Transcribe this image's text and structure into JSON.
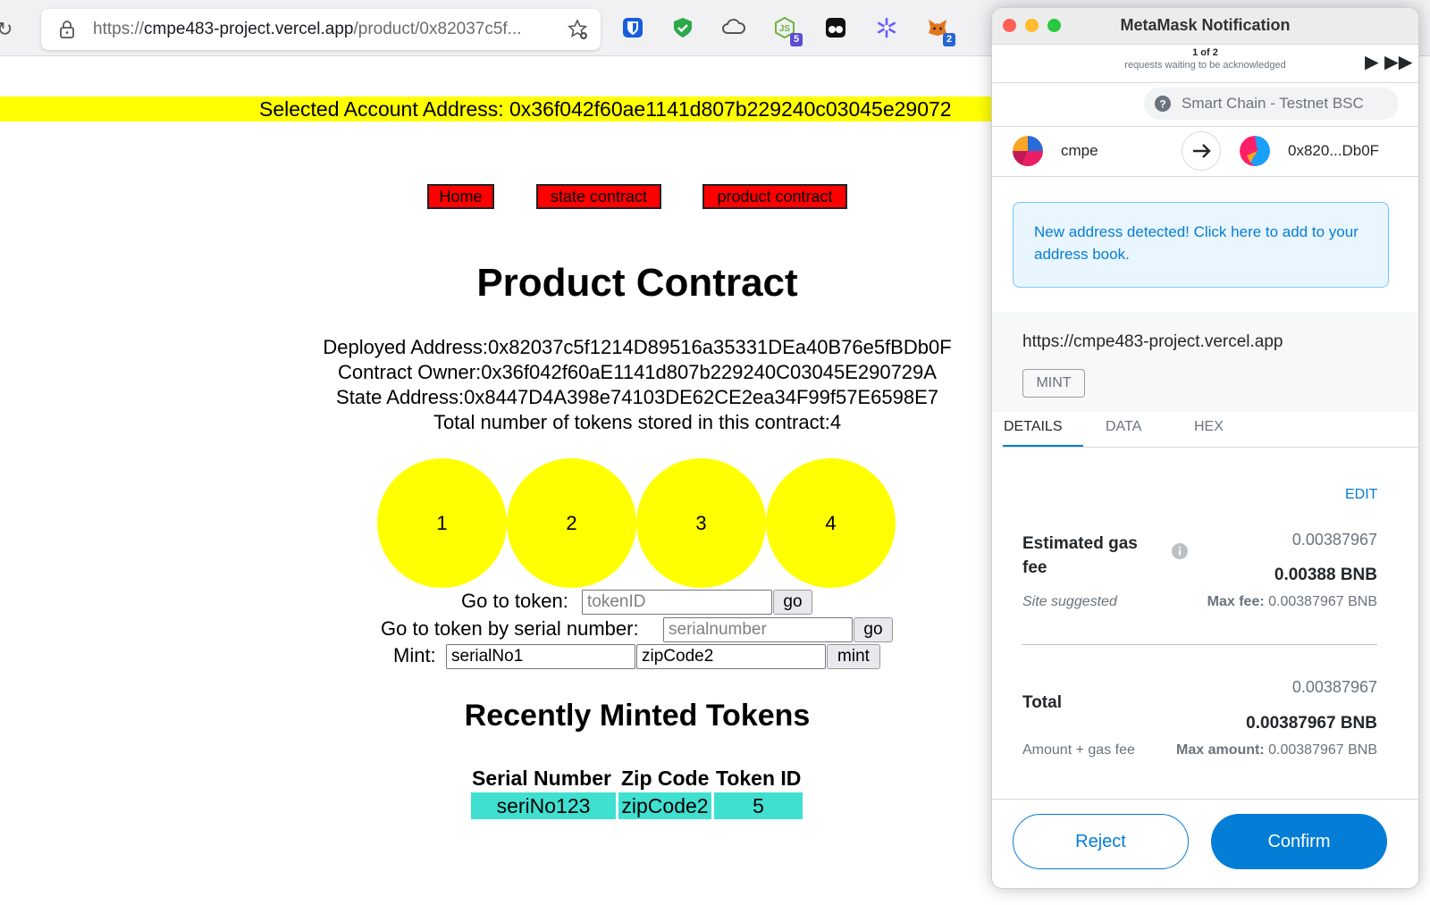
{
  "browser": {
    "url_prefix": "https://",
    "url_host": "cmpe483-project.vercel.app",
    "url_path": "/product/0x82037c5f...",
    "extensions": [
      {
        "name": "bitwarden",
        "color": "#175ddc",
        "badge": ""
      },
      {
        "name": "shield",
        "color": "#2ba84a",
        "badge": ""
      },
      {
        "name": "cloud",
        "color": "#555555",
        "badge": ""
      },
      {
        "name": "node",
        "color": "#6db33f",
        "badge": "5"
      },
      {
        "name": "tampermonkey",
        "color": "#111111",
        "badge": ""
      },
      {
        "name": "asterisk",
        "color": "#6a5cff",
        "badge": ""
      },
      {
        "name": "metamask",
        "color": "#e2761b",
        "badge": "2"
      }
    ]
  },
  "page": {
    "selected_account": "Selected Account Address: 0x36f042f60ae1141d807b229240c03045e29072",
    "nav": [
      "Home",
      "state contract",
      "product contract"
    ],
    "title": "Product Contract",
    "info": [
      "Deployed Address:0x82037c5f1214D89516a35331DEa40B76e5fBDb0F",
      "Contract Owner:0x36f042f60aE1141d807b229240C03045E290729A",
      "State Address:0x8447D4A398e74103DE62CE2ea34F99f57E6598E7",
      "Total number of tokens stored in this contract:4"
    ],
    "tokens": [
      "1",
      "2",
      "3",
      "4"
    ],
    "goto_token": {
      "label": "Go to token:",
      "placeholder": "tokenID",
      "button": "go"
    },
    "goto_serial": {
      "label": "Go to token by serial number:",
      "placeholder": "serialnumber",
      "button": "go"
    },
    "mint": {
      "label": "Mint:",
      "serial_value": "serialNo1",
      "zip_value": "zipCode2",
      "button": "mint"
    },
    "recent_title": "Recently Minted Tokens",
    "table": {
      "headers": [
        "Serial Number",
        "Zip Code",
        "Token ID"
      ],
      "rows": [
        [
          "seriNo123",
          "zipCode2",
          "5"
        ]
      ]
    }
  },
  "metamask": {
    "window_title": "MetaMask Notification",
    "pager_count": "1 of 2",
    "pager_text": "requests waiting to be acknowledged",
    "network": "Smart Chain - Testnet BSC",
    "from_account": "cmpe",
    "to_account": "0x820...Db0F",
    "notice": "New address detected! Click here to add to your address book.",
    "origin": "https://cmpe483-project.vercel.app",
    "method": "MINT",
    "tabs": [
      "DETAILS",
      "DATA",
      "HEX"
    ],
    "edit": "EDIT",
    "gas": {
      "label": "Estimated gas fee",
      "value_small": "0.00387967",
      "value_big": "0.00388 BNB",
      "site_suggested": "Site suggested",
      "max_fee_label": "Max fee:",
      "max_fee_value": "0.00387967 BNB"
    },
    "total": {
      "label": "Total",
      "value_small": "0.00387967",
      "value_big": "0.00387967 BNB",
      "sub": "Amount + gas fee",
      "max_amount_label": "Max amount:",
      "max_amount_value": "0.00387967 BNB"
    },
    "reject": "Reject",
    "confirm": "Confirm",
    "colors": {
      "accent": "#037dd6"
    }
  }
}
